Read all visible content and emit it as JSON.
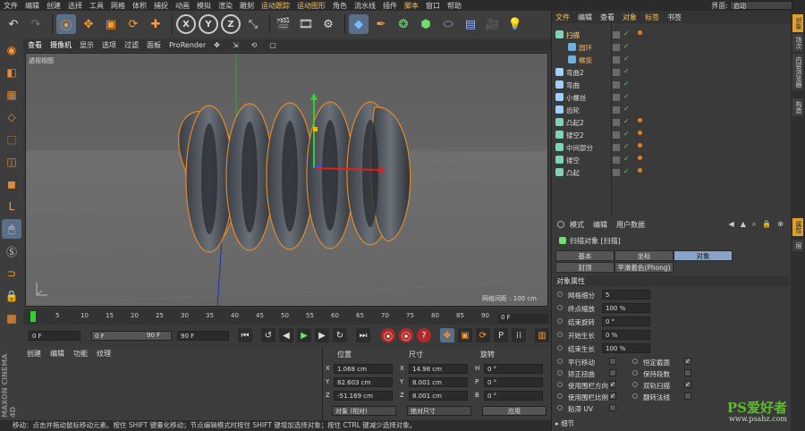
{
  "menubar": {
    "items": [
      "文件",
      "编辑",
      "创建",
      "选择",
      "工具",
      "网格",
      "体积",
      "捕捉",
      "动画",
      "模拟",
      "渲染",
      "雕刻",
      "运动跟踪",
      "运动图形",
      "角色",
      "流水线",
      "插件",
      "脚本",
      "窗口",
      "帮助"
    ],
    "layout_label": "界面:",
    "layout_value": "启动"
  },
  "toolbar": {
    "icons": [
      "undo-icon",
      "redo-icon",
      "live-select-icon",
      "move-icon",
      "scale-icon",
      "rotate-icon",
      "add-icon",
      "x-axis-icon",
      "y-axis-icon",
      "z-axis-icon",
      "coordinate-icon",
      "render-view-icon",
      "render-picture-icon",
      "render-settings-icon",
      "cube-icon",
      "pen-icon",
      "subdivision-icon",
      "array-icon",
      "deformer-icon",
      "floor-icon",
      "camera-icon",
      "light-icon"
    ],
    "xyz": [
      "X",
      "Y",
      "Z"
    ]
  },
  "left_toolbar": [
    "make-editable-icon",
    "model-mode-icon",
    "texture-mode-icon",
    "workplane-icon",
    "points-mode-icon",
    "edges-mode-icon",
    "polygons-mode-icon",
    "l-icon",
    "mouse-icon",
    "snap-icon",
    "magnet-icon",
    "lock-icon",
    "checker-icon"
  ],
  "viewport": {
    "menu": [
      "查看",
      "摄像机",
      "显示",
      "选项",
      "过滤",
      "面板",
      "ProRender"
    ],
    "label": "透视视图",
    "grid_spacing": "网格间距 : 100 cm"
  },
  "timeline": {
    "ticks": [
      "0",
      "5",
      "10",
      "15",
      "20",
      "25",
      "30",
      "35",
      "40",
      "45",
      "50",
      "55",
      "60",
      "65",
      "70",
      "75",
      "80",
      "85",
      "90"
    ],
    "current_frame": "0 F",
    "start": "0 F",
    "min": "0 F",
    "max": "90 F",
    "end": "90 F"
  },
  "bottom_left": {
    "menu": [
      "创建",
      "编辑",
      "功能",
      "纹理"
    ],
    "vertical_brand": "MAXON CINEMA 4D"
  },
  "coords": {
    "headers": {
      "position": "位置",
      "size": "尺寸",
      "rotation": "旋转"
    },
    "rows": [
      {
        "axis": "X",
        "pos": "1.068 cm",
        "size_axis": "X",
        "size": "14.98 cm",
        "rot_axis": "H",
        "rot": "0 °"
      },
      {
        "axis": "Y",
        "pos": "82.603 cm",
        "size_axis": "Y",
        "size": "8.001 cm",
        "rot_axis": "P",
        "rot": "0 °"
      },
      {
        "axis": "Z",
        "pos": "-51.169 cm",
        "size_axis": "Z",
        "size": "8.001 cm",
        "rot_axis": "B",
        "rot": "0 °"
      }
    ],
    "mode1": "对象 (相对)",
    "mode2": "绝对尺寸",
    "apply": "应用"
  },
  "status": "移动：点击并拖动鼠标移动元素。按住 SHIFT 键量化移动；节点编辑模式时按住 SHIFT 键增加选择对象；按住 CTRL 键减少选择对象。",
  "objects": {
    "menu": [
      "文件",
      "编辑",
      "查看",
      "对象",
      "标签",
      "书签"
    ],
    "rows": [
      {
        "name": "扫描",
        "indent": 0,
        "color": "#7fd3b8",
        "hl": true,
        "tag": true
      },
      {
        "name": "圆环",
        "indent": 1,
        "color": "#6fb0e0",
        "hl": true,
        "tag": false
      },
      {
        "name": "螺旋",
        "indent": 1,
        "color": "#6fb0e0",
        "hl": true,
        "tag": false
      },
      {
        "name": "弯曲2",
        "indent": 0,
        "color": "#9fd0ff",
        "hl": false,
        "tag": false
      },
      {
        "name": "弯曲",
        "indent": 0,
        "color": "#9fd0ff",
        "hl": false,
        "tag": false
      },
      {
        "name": "小螺丝",
        "indent": 0,
        "color": "#9fd0ff",
        "hl": false,
        "tag": false
      },
      {
        "name": "齿轮",
        "indent": 0,
        "color": "#9fd0ff",
        "hl": false,
        "tag": false
      },
      {
        "name": "凸起2",
        "indent": 0,
        "color": "#7fd3b8",
        "hl": false,
        "tag": true
      },
      {
        "name": "镂空2",
        "indent": 0,
        "color": "#7fd3b8",
        "hl": false,
        "tag": true
      },
      {
        "name": "中间部分",
        "indent": 0,
        "color": "#7fd3b8",
        "hl": false,
        "tag": true
      },
      {
        "name": "镂空",
        "indent": 0,
        "color": "#7fd3b8",
        "hl": false,
        "tag": true
      },
      {
        "name": "凸起",
        "indent": 0,
        "color": "#7fd3b8",
        "hl": false,
        "tag": true
      }
    ]
  },
  "side_tabs": [
    "对象",
    "场次",
    "内容浏览器",
    "构造",
    "属性",
    "层"
  ],
  "attributes": {
    "menu": [
      "模式",
      "编辑",
      "用户数据"
    ],
    "title": "扫描对象 [扫描]",
    "tabs": [
      "基本",
      "坐标",
      "对象"
    ],
    "tabs2": [
      "封顶",
      "平滑着色(Phong)"
    ],
    "section": "对象属性",
    "rows": [
      {
        "label": "网格细分",
        "value": "5"
      },
      {
        "label": "终点缩放",
        "value": "100 %"
      },
      {
        "label": "结束旋转",
        "value": "0 °"
      },
      {
        "label": "开始生长",
        "value": "0 %"
      },
      {
        "label": "结束生长",
        "value": "100 %"
      }
    ],
    "checks": [
      {
        "label": "平行移动",
        "checked": false,
        "label2": "恒定截面",
        "checked2": true
      },
      {
        "label": "矫正扭曲",
        "checked": false,
        "label2": "保持段数",
        "checked2": false
      },
      {
        "label": "使用围栏方向",
        "checked": true,
        "label2": "双轨扫描",
        "checked2": true
      },
      {
        "label": "使用围栏比例",
        "checked": true,
        "label2": "翻转法线",
        "checked2": false
      },
      {
        "label": "粘滞 UV",
        "checked": false,
        "label2": "",
        "checked2": false
      }
    ],
    "details": "细节"
  },
  "watermark": {
    "brand": "PS爱好者",
    "url": "www.psahz.com"
  }
}
